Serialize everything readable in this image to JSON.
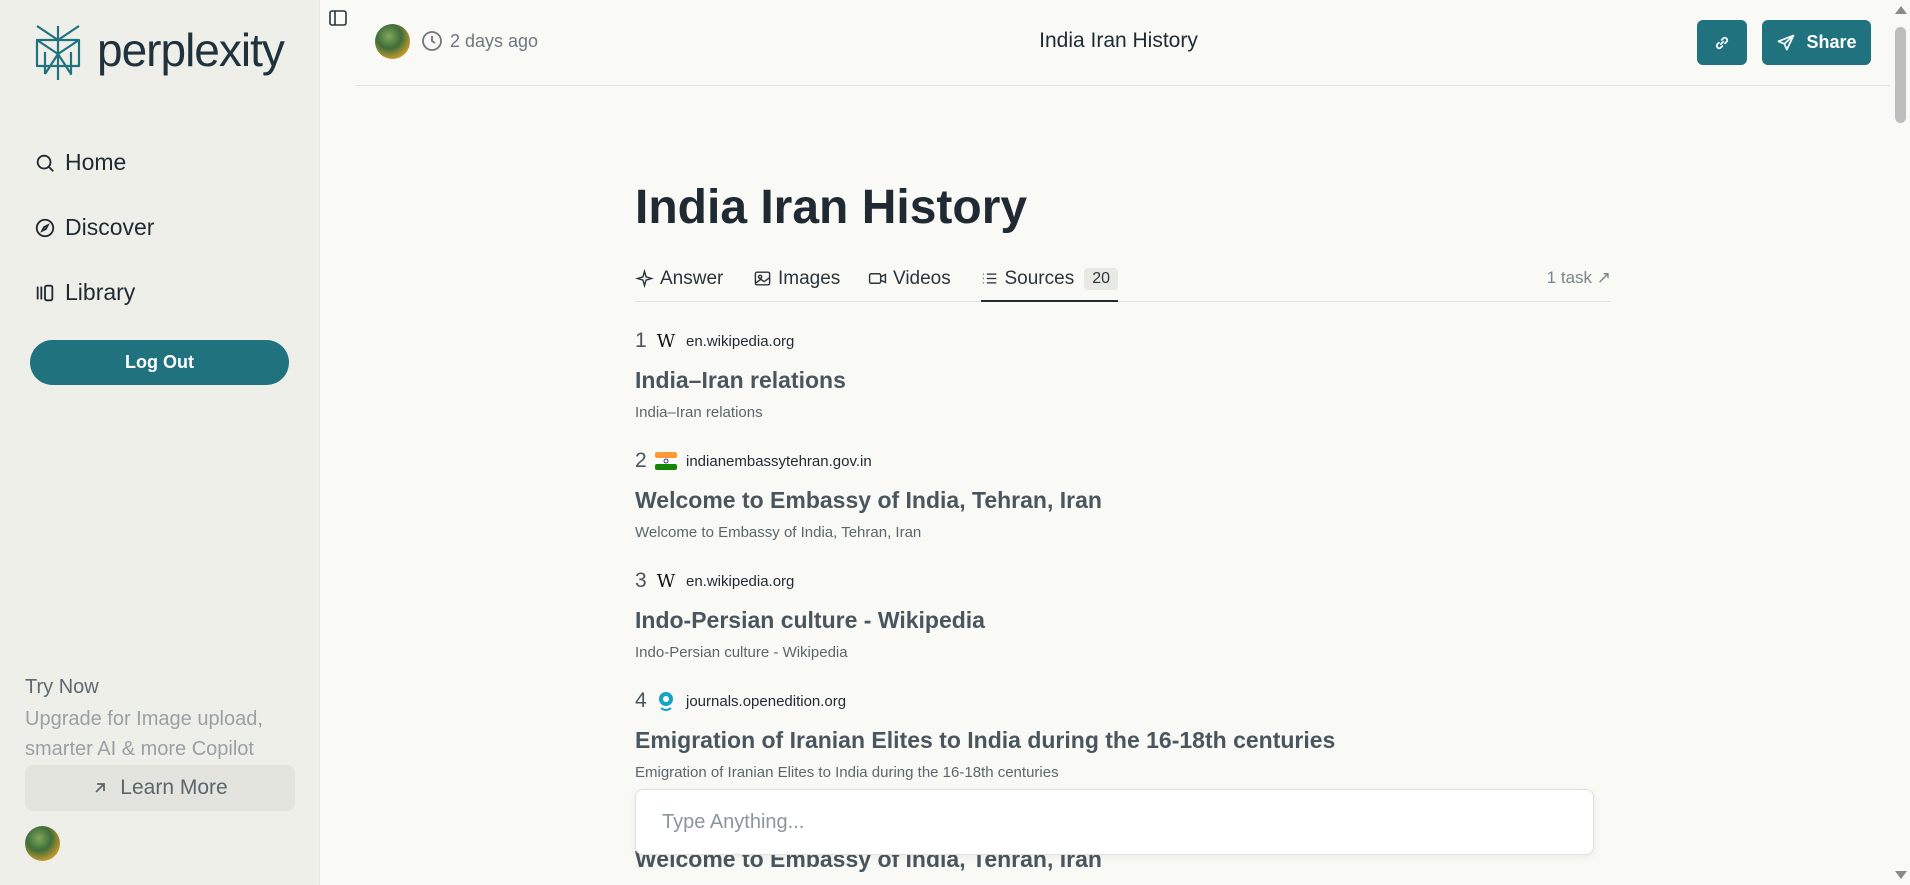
{
  "sidebar": {
    "logo_text": "perplexity",
    "nav": [
      {
        "label": "Home",
        "icon": "search-icon"
      },
      {
        "label": "Discover",
        "icon": "compass-icon"
      },
      {
        "label": "Library",
        "icon": "library-icon"
      }
    ],
    "logout_label": "Log Out",
    "promo": {
      "title": "Try Now",
      "text": "Upgrade for Image upload, smarter AI & more Copilot",
      "button_label": "Learn More"
    }
  },
  "header": {
    "time_ago": "2 days ago",
    "title": "India Iran History",
    "share_label": "Share"
  },
  "main": {
    "title": "India Iran History",
    "tabs": [
      {
        "label": "Answer",
        "icon": "sparkle-icon"
      },
      {
        "label": "Images",
        "icon": "image-icon"
      },
      {
        "label": "Videos",
        "icon": "video-icon"
      },
      {
        "label": "Sources",
        "icon": "list-icon",
        "count": "20"
      }
    ],
    "task_link": "1 task ↗",
    "sources": [
      {
        "num": "1",
        "domain": "en.wikipedia.org",
        "favicon": "wikipedia-icon",
        "title": "India–Iran relations",
        "snippet": "India–Iran relations"
      },
      {
        "num": "2",
        "domain": "indianembassytehran.gov.in",
        "favicon": "india-flag-icon",
        "title": "Welcome to Embassy of India, Tehran, Iran",
        "snippet": "Welcome to Embassy of India, Tehran, Iran"
      },
      {
        "num": "3",
        "domain": "en.wikipedia.org",
        "favicon": "wikipedia-icon",
        "title": "Indo-Persian culture - Wikipedia",
        "snippet": "Indo-Persian culture - Wikipedia"
      },
      {
        "num": "4",
        "domain": "journals.openedition.org",
        "favicon": "openedition-icon",
        "title": "Emigration of Iranian Elites to India during the 16-18th centuries",
        "snippet": "Emigration of Iranian Elites to India during the 16-18th centuries"
      }
    ],
    "peek_title": "Welcome to Embassy of India, Tehran, Iran"
  },
  "composer": {
    "placeholder": "Type Anything..."
  },
  "colors": {
    "accent": "#20727f",
    "sidebar_bg": "#efefea",
    "page_bg": "#f9f9f6"
  }
}
